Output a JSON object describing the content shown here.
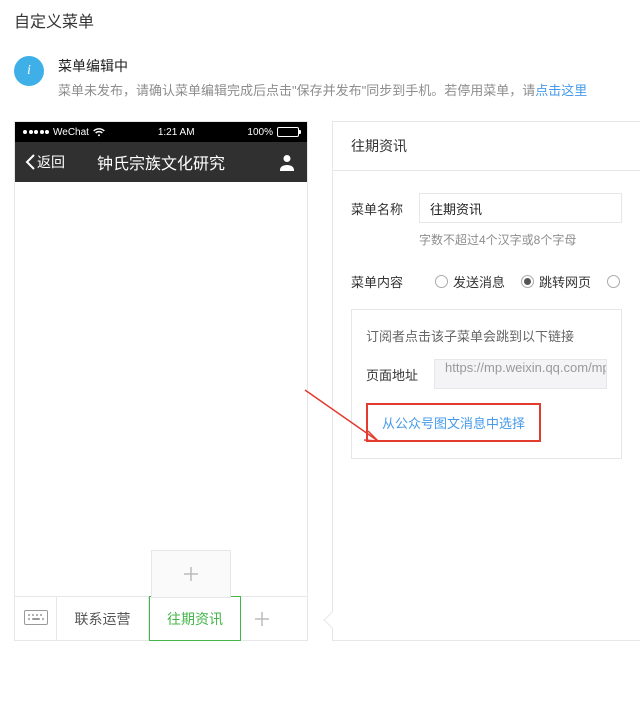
{
  "page_title": "自定义菜单",
  "info": {
    "title": "菜单编辑中",
    "desc_prefix": "菜单未发布，请确认菜单编辑完成后点击\"保存并发布\"同步到手机。若停用菜单，请",
    "link_text": "点击这里"
  },
  "phone": {
    "carrier": "WeChat",
    "time": "1:21 AM",
    "battery": "100%",
    "back": "返回",
    "title": "钟氏宗族文化研究",
    "menus": [
      "联系运营",
      "往期资讯"
    ],
    "active_index": 1
  },
  "panel": {
    "header": "往期资讯",
    "name_label": "菜单名称",
    "name_value": "往期资讯",
    "name_hint": "字数不超过4个汉字或8个字母",
    "content_label": "菜单内容",
    "options": [
      "发送消息",
      "跳转网页"
    ],
    "content_selected": 1,
    "link_desc": "订阅者点击该子菜单会跳到以下链接",
    "url_label": "页面地址",
    "url_value": "https://mp.weixin.qq.com/mp",
    "select_link": "从公众号图文消息中选择"
  }
}
